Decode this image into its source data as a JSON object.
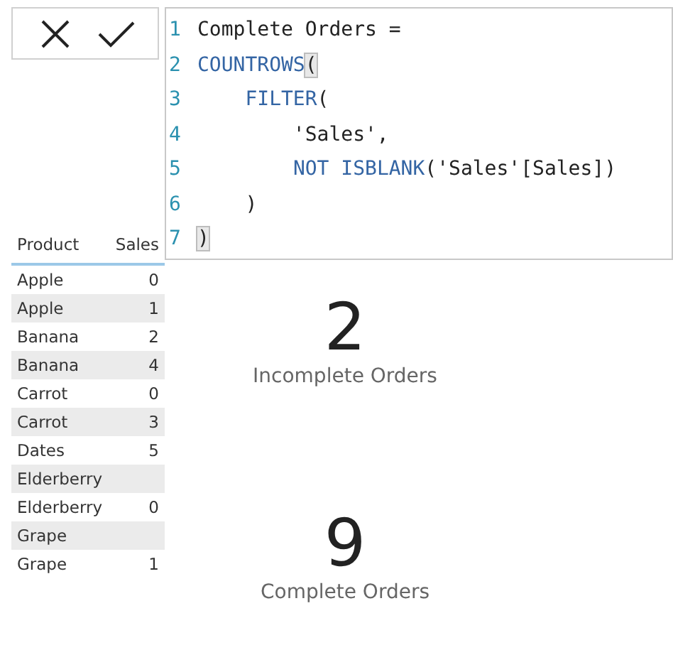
{
  "editor": {
    "lines": [
      {
        "number": "1",
        "tokens": [
          {
            "kind": "text",
            "text": "Complete Orders ="
          }
        ]
      },
      {
        "number": "2",
        "tokens": [
          {
            "kind": "function",
            "text": "COUNTROWS"
          },
          {
            "kind": "match",
            "text": "("
          }
        ]
      },
      {
        "number": "3",
        "tokens": [
          {
            "kind": "function",
            "text": "    FILTER"
          },
          {
            "kind": "text",
            "text": "("
          }
        ]
      },
      {
        "number": "4",
        "tokens": [
          {
            "kind": "text",
            "text": "        'Sales',"
          }
        ]
      },
      {
        "number": "5",
        "tokens": [
          {
            "kind": "function",
            "text": "        NOT ISBLANK"
          },
          {
            "kind": "text",
            "text": "('Sales'[Sales])"
          }
        ]
      },
      {
        "number": "6",
        "tokens": [
          {
            "kind": "text",
            "text": "    )"
          }
        ]
      },
      {
        "number": "7",
        "tokens": [
          {
            "kind": "match",
            "text": ")"
          }
        ]
      }
    ]
  },
  "table": {
    "columns": [
      "Product",
      "Sales"
    ],
    "rows": [
      {
        "product": "Apple",
        "sales": "0"
      },
      {
        "product": "Apple",
        "sales": "1"
      },
      {
        "product": "Banana",
        "sales": "2"
      },
      {
        "product": "Banana",
        "sales": "4"
      },
      {
        "product": "Carrot",
        "sales": "0"
      },
      {
        "product": "Carrot",
        "sales": "3"
      },
      {
        "product": "Dates",
        "sales": "5"
      },
      {
        "product": "Elderberry"
      },
      {
        "product": "Elderberry",
        "sales": "0"
      },
      {
        "product": "Grape"
      },
      {
        "product": "Grape",
        "sales": "1"
      }
    ]
  },
  "cards": [
    {
      "value": "2",
      "label": "Incomplete Orders"
    },
    {
      "value": "9",
      "label": "Complete Orders"
    }
  ]
}
